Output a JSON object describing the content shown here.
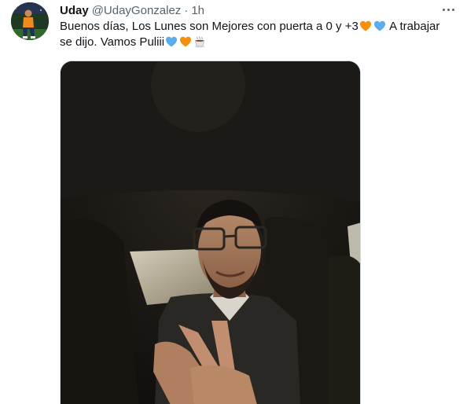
{
  "tweet": {
    "display_name": "Uday",
    "handle": "@UdayGonzalez",
    "separator": "·",
    "time": "1h",
    "text_part1": "Buenos días, Los Lunes son Mejores con puerta a 0 y +3",
    "text_part2": " A trabajar se dijo. Vamos Puliii",
    "more_icon": "more-icon"
  },
  "media": {
    "icon": "video-thumbnail"
  },
  "colors": {
    "handle": "#536471",
    "text": "#0f1419",
    "orange_heart": "#f4900c",
    "blue_heart": "#5dadec"
  }
}
